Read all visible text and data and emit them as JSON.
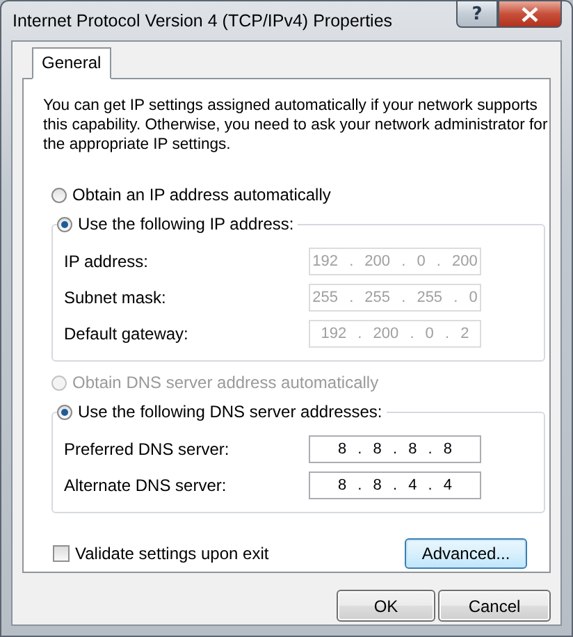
{
  "window": {
    "title": "Internet Protocol Version 4 (TCP/IPv4) Properties",
    "help_label": "?"
  },
  "tabs": [
    {
      "label": "General",
      "selected": true
    }
  ],
  "intro": "You can get IP settings assigned automatically if your network supports this capability. Otherwise, you need to ask your network administrator for the appropriate IP settings.",
  "ip_section": {
    "auto_option": {
      "label": "Obtain an IP address automatically",
      "selected": false,
      "disabled": false
    },
    "manual_option": {
      "label": "Use the following IP address:",
      "selected": true,
      "disabled": false
    },
    "fields": [
      {
        "label": "IP address:",
        "value": "192 . 200 . 0 . 200",
        "disabled": true
      },
      {
        "label": "Subnet mask:",
        "value": "255 . 255 . 255 . 0",
        "disabled": true
      },
      {
        "label": "Default gateway:",
        "value": "192 . 200 . 0 . 2",
        "disabled": true
      }
    ]
  },
  "dns_section": {
    "auto_option": {
      "label": "Obtain DNS server address automatically",
      "selected": false,
      "disabled": true
    },
    "manual_option": {
      "label": "Use the following DNS server addresses:",
      "selected": true,
      "disabled": false
    },
    "fields": [
      {
        "label": "Preferred DNS server:",
        "value": "8 . 8 . 8 . 8",
        "disabled": false
      },
      {
        "label": "Alternate DNS server:",
        "value": "8 . 8 . 4 . 4",
        "disabled": false
      }
    ]
  },
  "validate": {
    "label": "Validate settings upon exit",
    "checked": false
  },
  "advanced_button": {
    "label": "Advanced...",
    "focused": true
  },
  "buttons": [
    {
      "label": "OK"
    },
    {
      "label": "Cancel"
    }
  ]
}
